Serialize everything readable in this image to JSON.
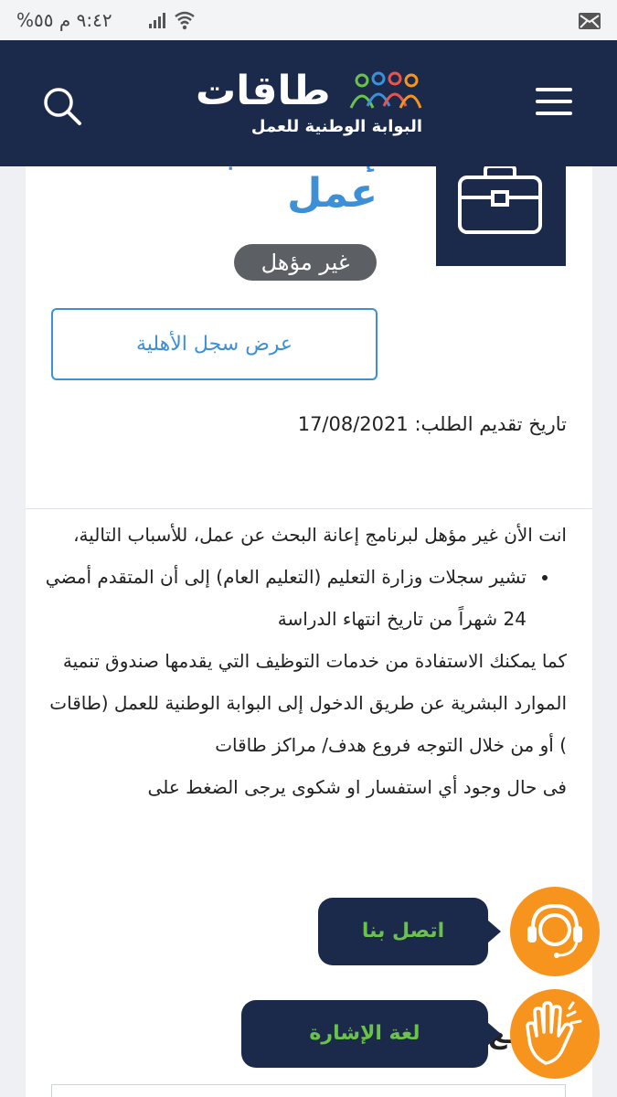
{
  "status_bar": {
    "time_battery": "٩:٤٢ م  ٥٥%",
    "icons": [
      "mail-icon",
      "wifi-icon",
      "signal-icon",
      "battery-icon"
    ]
  },
  "header": {
    "logo_word": "طاقات",
    "logo_subtitle": "البوابة الوطنية للعمل",
    "icons": [
      "menu-icon",
      "search-icon"
    ],
    "colors": {
      "background": "#1b2a4a",
      "accent_blue": "#3d8fd6"
    }
  },
  "program": {
    "title_line1": "إعانة البحث عن",
    "title_line2": "عمل",
    "status_badge": "غير مؤهل",
    "eligibility_button": "عرض سجل الأهلية",
    "date_label": "تاريخ تقديم الطلب:",
    "date_value": "17/08/2021"
  },
  "message": {
    "intro": "انت الأن غير مؤهل لبرنامج إعانة البحث عن عمل، للأسباب التالية،",
    "reasons": [
      "تشير سجلات وزارة التعليم (التعليم العام) إلى أن المتقدم أمضي 24 شهراً من تاريخ انتهاء الدراسة"
    ],
    "services": "كما يمكنك الاستفادة من خدمات التوظيف التي يقدمها صندوق تنمية الموارد البشرية عن طريق الدخول إلى البوابة الوطنية للعمل (طاقات ) أو من خلال التوجه فروع هدف/ مراكز طاقات",
    "contact": "فى حال وجود أي استفسار او شكوى يرجى الضغط على"
  },
  "floating": {
    "contact_label": "اتصل بنا",
    "sign_label": "لغة الإشارة",
    "colors": {
      "bubble": "#1b2a4a",
      "label": "#6bc24a",
      "circle": "#f7941d"
    }
  }
}
